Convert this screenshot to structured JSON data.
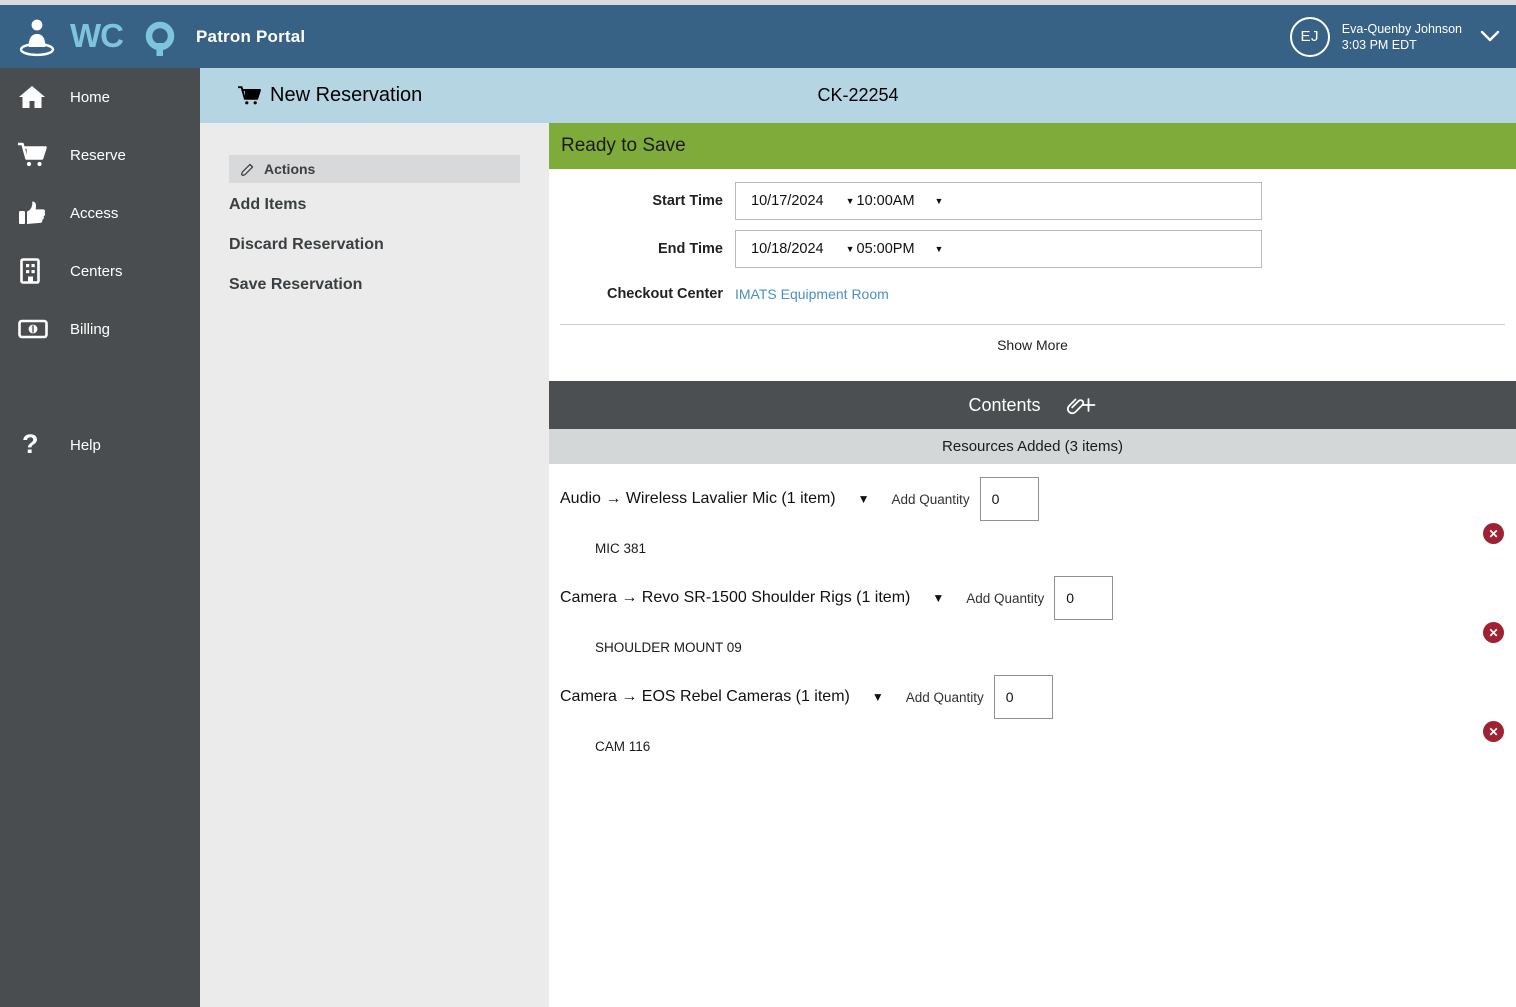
{
  "brand": {
    "logo_icon": "wco-person-logo-icon",
    "wordmark": "WCO",
    "product": "Patron Portal"
  },
  "user": {
    "initials": "EJ",
    "name": "Eva-Quenby Johnson",
    "time": "3:03 PM EDT",
    "chevron_icon": "chevron-down-icon"
  },
  "sidebar": {
    "items": [
      {
        "label": "Home",
        "icon": "home-icon"
      },
      {
        "label": "Reserve",
        "icon": "shopping-cart-icon"
      },
      {
        "label": "Access",
        "icon": "thumbs-up-icon"
      },
      {
        "label": "Centers",
        "icon": "building-icon"
      },
      {
        "label": "Billing",
        "icon": "money-bill-icon"
      },
      {
        "label": "Help",
        "icon": "question-mark-icon"
      }
    ]
  },
  "page_header": {
    "icon": "shopping-cart-icon",
    "title": "New Reservation",
    "code": "CK-22254"
  },
  "actions": {
    "heading": "Actions",
    "heading_icon": "pencil-icon",
    "items": [
      {
        "label": "Add Items"
      },
      {
        "label": "Discard Reservation"
      },
      {
        "label": "Save Reservation"
      }
    ]
  },
  "reservation": {
    "status": "Ready to Save",
    "start_time": {
      "label": "Start Time",
      "date": "10/17/2024",
      "time": "10:00AM",
      "caret_icon": "caret-down-icon"
    },
    "end_time": {
      "label": "End Time",
      "date": "10/18/2024",
      "time": "05:00PM",
      "caret_icon": "caret-down-icon"
    },
    "checkout_center": {
      "label": "Checkout Center",
      "value": "IMATS Equipment Room"
    },
    "show_more": "Show More"
  },
  "contents": {
    "title": "Contents",
    "attach_icon": "paperclip-plus-icon",
    "resources_added": "Resources Added (3 items)",
    "rows": [
      {
        "name": "Audio → Wireless Lavalier Mic (1 item)",
        "caret_icon": "caret-down-icon",
        "qty_label": "Add Quantity",
        "qty_value": "0",
        "item_tag": "MIC 381",
        "delete_icon": "remove-circle-icon"
      },
      {
        "name": "Camera → Revo SR-1500 Shoulder Rigs (1 item)",
        "caret_icon": "caret-down-icon",
        "qty_label": "Add Quantity",
        "qty_value": "0",
        "item_tag": "SHOULDER MOUNT 09",
        "delete_icon": "remove-circle-icon"
      },
      {
        "name": "Camera → EOS Rebel Cameras (1 item)",
        "caret_icon": "caret-down-icon",
        "qty_label": "Add Quantity",
        "qty_value": "0",
        "item_tag": "CAM 116",
        "delete_icon": "remove-circle-icon"
      }
    ]
  },
  "colors": {
    "header_blue": "#376285",
    "sidebar_gray": "#494d4f",
    "page_header_blue": "#b5d5e2",
    "status_green": "#7fab3b",
    "contents_dark": "#4b4f51",
    "resources_gray": "#d4d7d8",
    "link_blue": "#4a90c4",
    "delete_red": "#9e2233",
    "actions_panel": "#ebebeb"
  }
}
